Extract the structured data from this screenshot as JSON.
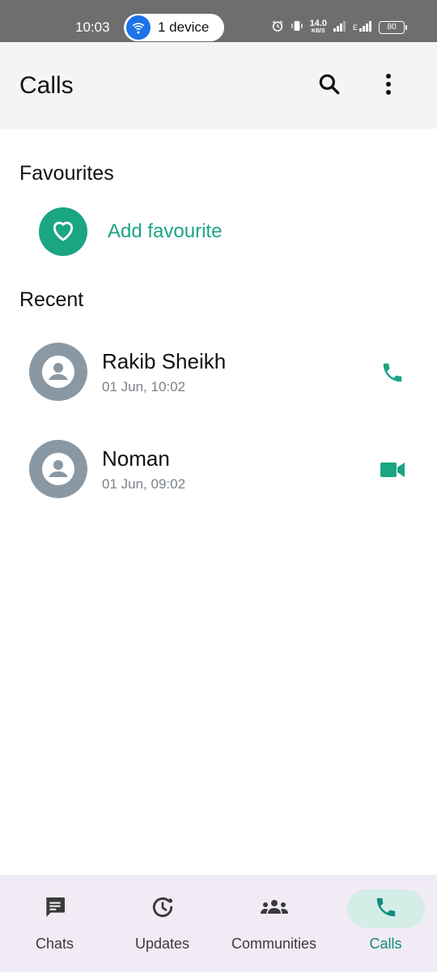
{
  "status_bar": {
    "time": "10:03",
    "pill_label": "1 device",
    "speed_value": "14.0",
    "speed_unit": "KB/S",
    "network_label": "E",
    "battery": "80"
  },
  "app_bar": {
    "title": "Calls"
  },
  "favourites": {
    "title": "Favourites",
    "add_label": "Add favourite"
  },
  "recent": {
    "title": "Recent",
    "items": [
      {
        "name": "Rakib Sheikh",
        "timestamp": "01 Jun, 10:02",
        "call_type": "phone-icon"
      },
      {
        "name": "Noman",
        "timestamp": "01 Jun, 09:02",
        "call_type": "video-icon"
      }
    ]
  },
  "bottom_nav": {
    "items": [
      {
        "label": "Chats",
        "icon": "chat-icon"
      },
      {
        "label": "Updates",
        "icon": "updates-icon"
      },
      {
        "label": "Communities",
        "icon": "communities-icon"
      },
      {
        "label": "Calls",
        "icon": "phone-icon"
      }
    ],
    "active": "Calls"
  },
  "colors": {
    "accent": "#1aa583",
    "active_nav_bg": "#d4ede7",
    "avatar_bg": "#8a98a4",
    "nav_bg": "#f1ebf5"
  }
}
